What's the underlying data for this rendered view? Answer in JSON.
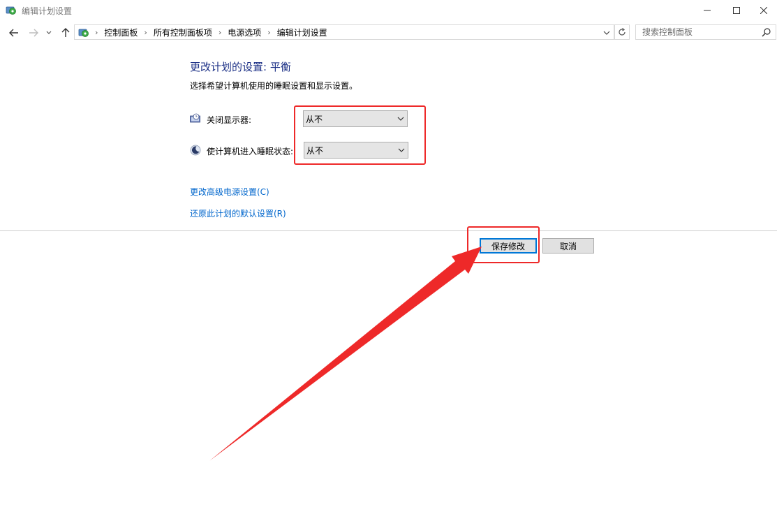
{
  "window": {
    "title": "编辑计划设置",
    "controls": [
      "minimize-icon",
      "maximize-icon",
      "close-icon"
    ]
  },
  "nav": {
    "back_icon": "arrow-left-icon",
    "forward_icon": "arrow-right-icon",
    "recent_icon": "chevron-down-icon",
    "up_icon": "arrow-up-icon",
    "breadcrumbs": [
      "控制面板",
      "所有控制面板项",
      "电源选项",
      "编辑计划设置"
    ],
    "refresh_icon": "refresh-icon",
    "search_placeholder": "搜索控制面板"
  },
  "main": {
    "heading": "更改计划的设置: 平衡",
    "subtitle": "选择希望计算机使用的睡眠设置和显示设置。",
    "settings": [
      {
        "icon": "display-off-icon",
        "label": "关闭显示器:",
        "value": "从不"
      },
      {
        "icon": "sleep-moon-icon",
        "label": "使计算机进入睡眠状态:",
        "value": "从不"
      }
    ],
    "links": [
      "更改高级电源设置(C)",
      "还原此计划的默认设置(R)"
    ]
  },
  "buttons": {
    "save": "保存修改",
    "cancel": "取消"
  },
  "annotation": {
    "color": "#ee2929"
  },
  "colors": {
    "heading": "#1e3287",
    "link": "#0066cc",
    "focus": "#0078d7"
  }
}
